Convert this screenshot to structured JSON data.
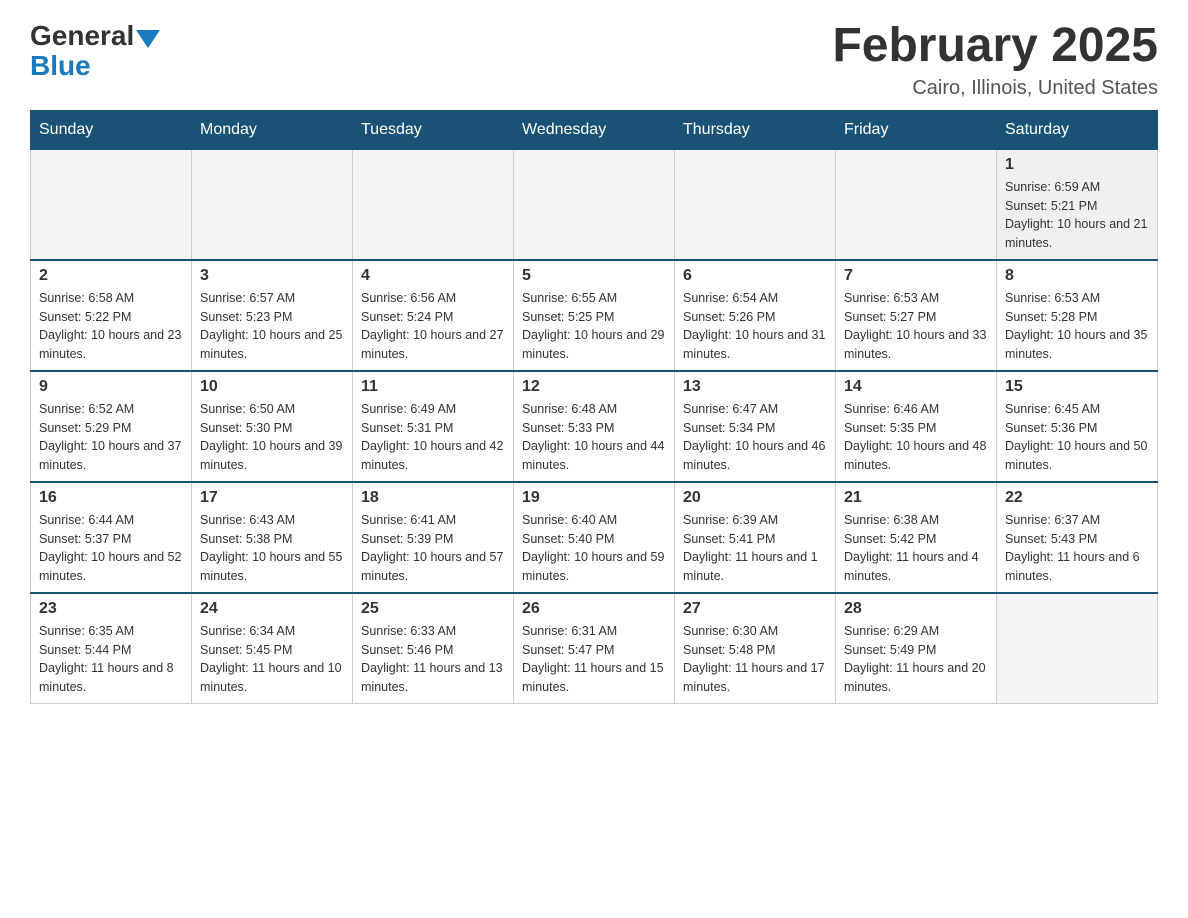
{
  "header": {
    "logo_general": "General",
    "logo_blue": "Blue",
    "title": "February 2025",
    "subtitle": "Cairo, Illinois, United States"
  },
  "days_of_week": [
    "Sunday",
    "Monday",
    "Tuesday",
    "Wednesday",
    "Thursday",
    "Friday",
    "Saturday"
  ],
  "weeks": [
    {
      "days": [
        {
          "num": "",
          "info": ""
        },
        {
          "num": "",
          "info": ""
        },
        {
          "num": "",
          "info": ""
        },
        {
          "num": "",
          "info": ""
        },
        {
          "num": "",
          "info": ""
        },
        {
          "num": "",
          "info": ""
        },
        {
          "num": "1",
          "info": "Sunrise: 6:59 AM\nSunset: 5:21 PM\nDaylight: 10 hours and 21 minutes."
        }
      ]
    },
    {
      "days": [
        {
          "num": "2",
          "info": "Sunrise: 6:58 AM\nSunset: 5:22 PM\nDaylight: 10 hours and 23 minutes."
        },
        {
          "num": "3",
          "info": "Sunrise: 6:57 AM\nSunset: 5:23 PM\nDaylight: 10 hours and 25 minutes."
        },
        {
          "num": "4",
          "info": "Sunrise: 6:56 AM\nSunset: 5:24 PM\nDaylight: 10 hours and 27 minutes."
        },
        {
          "num": "5",
          "info": "Sunrise: 6:55 AM\nSunset: 5:25 PM\nDaylight: 10 hours and 29 minutes."
        },
        {
          "num": "6",
          "info": "Sunrise: 6:54 AM\nSunset: 5:26 PM\nDaylight: 10 hours and 31 minutes."
        },
        {
          "num": "7",
          "info": "Sunrise: 6:53 AM\nSunset: 5:27 PM\nDaylight: 10 hours and 33 minutes."
        },
        {
          "num": "8",
          "info": "Sunrise: 6:53 AM\nSunset: 5:28 PM\nDaylight: 10 hours and 35 minutes."
        }
      ]
    },
    {
      "days": [
        {
          "num": "9",
          "info": "Sunrise: 6:52 AM\nSunset: 5:29 PM\nDaylight: 10 hours and 37 minutes."
        },
        {
          "num": "10",
          "info": "Sunrise: 6:50 AM\nSunset: 5:30 PM\nDaylight: 10 hours and 39 minutes."
        },
        {
          "num": "11",
          "info": "Sunrise: 6:49 AM\nSunset: 5:31 PM\nDaylight: 10 hours and 42 minutes."
        },
        {
          "num": "12",
          "info": "Sunrise: 6:48 AM\nSunset: 5:33 PM\nDaylight: 10 hours and 44 minutes."
        },
        {
          "num": "13",
          "info": "Sunrise: 6:47 AM\nSunset: 5:34 PM\nDaylight: 10 hours and 46 minutes."
        },
        {
          "num": "14",
          "info": "Sunrise: 6:46 AM\nSunset: 5:35 PM\nDaylight: 10 hours and 48 minutes."
        },
        {
          "num": "15",
          "info": "Sunrise: 6:45 AM\nSunset: 5:36 PM\nDaylight: 10 hours and 50 minutes."
        }
      ]
    },
    {
      "days": [
        {
          "num": "16",
          "info": "Sunrise: 6:44 AM\nSunset: 5:37 PM\nDaylight: 10 hours and 52 minutes."
        },
        {
          "num": "17",
          "info": "Sunrise: 6:43 AM\nSunset: 5:38 PM\nDaylight: 10 hours and 55 minutes."
        },
        {
          "num": "18",
          "info": "Sunrise: 6:41 AM\nSunset: 5:39 PM\nDaylight: 10 hours and 57 minutes."
        },
        {
          "num": "19",
          "info": "Sunrise: 6:40 AM\nSunset: 5:40 PM\nDaylight: 10 hours and 59 minutes."
        },
        {
          "num": "20",
          "info": "Sunrise: 6:39 AM\nSunset: 5:41 PM\nDaylight: 11 hours and 1 minute."
        },
        {
          "num": "21",
          "info": "Sunrise: 6:38 AM\nSunset: 5:42 PM\nDaylight: 11 hours and 4 minutes."
        },
        {
          "num": "22",
          "info": "Sunrise: 6:37 AM\nSunset: 5:43 PM\nDaylight: 11 hours and 6 minutes."
        }
      ]
    },
    {
      "days": [
        {
          "num": "23",
          "info": "Sunrise: 6:35 AM\nSunset: 5:44 PM\nDaylight: 11 hours and 8 minutes."
        },
        {
          "num": "24",
          "info": "Sunrise: 6:34 AM\nSunset: 5:45 PM\nDaylight: 11 hours and 10 minutes."
        },
        {
          "num": "25",
          "info": "Sunrise: 6:33 AM\nSunset: 5:46 PM\nDaylight: 11 hours and 13 minutes."
        },
        {
          "num": "26",
          "info": "Sunrise: 6:31 AM\nSunset: 5:47 PM\nDaylight: 11 hours and 15 minutes."
        },
        {
          "num": "27",
          "info": "Sunrise: 6:30 AM\nSunset: 5:48 PM\nDaylight: 11 hours and 17 minutes."
        },
        {
          "num": "28",
          "info": "Sunrise: 6:29 AM\nSunset: 5:49 PM\nDaylight: 11 hours and 20 minutes."
        },
        {
          "num": "",
          "info": ""
        }
      ]
    }
  ]
}
